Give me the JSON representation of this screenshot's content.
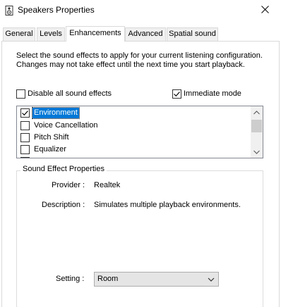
{
  "window": {
    "title": "Speakers Properties",
    "icon": "speaker-icon",
    "close_icon": "close-icon"
  },
  "tabs": [
    {
      "label": "General",
      "active": false
    },
    {
      "label": "Levels",
      "active": false
    },
    {
      "label": "Enhancements",
      "active": true
    },
    {
      "label": "Advanced",
      "active": false
    },
    {
      "label": "Spatial sound",
      "active": false
    }
  ],
  "enhancements": {
    "description": "Select the sound effects to apply for your current listening configuration. Changes may not take effect until the next time you start playback.",
    "disable_all": {
      "label": "Disable all sound effects",
      "checked": false
    },
    "immediate_mode": {
      "label": "Immediate mode",
      "checked": true
    },
    "effects": [
      {
        "label": "Environment",
        "checked": true,
        "selected": true
      },
      {
        "label": "Voice Cancellation",
        "checked": false,
        "selected": false
      },
      {
        "label": "Pitch Shift",
        "checked": false,
        "selected": false
      },
      {
        "label": "Equalizer",
        "checked": false,
        "selected": false
      }
    ],
    "properties": {
      "group_title": "Sound Effect Properties",
      "provider_label": "Provider :",
      "provider_value": "Realtek",
      "description_label": "Description :",
      "description_value": "Simulates multiple playback environments.",
      "setting_label": "Setting :",
      "setting_value": "Room"
    }
  },
  "colors": {
    "selection": "#0078d7",
    "border": "#d9d9d9"
  }
}
